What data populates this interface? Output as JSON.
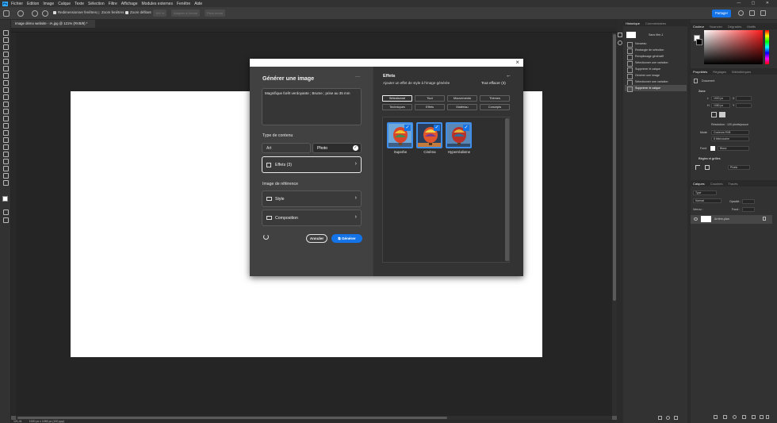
{
  "app": {
    "logo": "Ps",
    "menu": [
      "Fichier",
      "Edition",
      "Image",
      "Calque",
      "Texte",
      "Sélection",
      "Filtre",
      "Affichage",
      "Modules externes",
      "Fenêtre",
      "Aide"
    ],
    "window_controls": "— ▢ ✕"
  },
  "options_bar": {
    "resize_windows": "Redimensionner fenêtres",
    "zoom_windows": "Zoom fenêtres",
    "scrubby_zoom": "Zoom défilant",
    "zoom_100": "100 %",
    "fit_screen": "Adapter à l'écran",
    "fill_screen": "Plein écran",
    "share_label": "Partager"
  },
  "document": {
    "tab_title": "Image démo website - IA.jpg @ 121% (RVB/8) *",
    "status_zoom": "121,41",
    "status_info": "1920 px x 1080 px (120 ppp)"
  },
  "history_panel": {
    "tabs": [
      "Historique",
      "Commentaires"
    ],
    "snapshot": "Sans titre-1",
    "items": [
      "Nouveau",
      "Rectangle de sélection",
      "Remplissage génératif",
      "Sélectionner une variation",
      "Supprimer le calque",
      "Générer une image",
      "Sélectionner une variation",
      "Supprimer le calque"
    ],
    "selected_index": 7
  },
  "color_panel": {
    "tabs": [
      "Couleur",
      "Nuancier",
      "Dégradés",
      "Motifs"
    ]
  },
  "properties_panel": {
    "tabs": [
      "Propriétés",
      "Réglages",
      "Bibliothèques"
    ],
    "doc_label": "Document",
    "canvas_section": "Zone",
    "width_label": "L",
    "width_value": "1920 px",
    "height_label": "H",
    "height_value": "1080 px",
    "x_label": "X",
    "y_label": "Y",
    "resolution": "Résolution : 120 pixels/pouce",
    "mode_label": "Mode",
    "mode_value": "Couleurs RVB",
    "depth_value": "8 bits/couche",
    "fill_label": "Fond",
    "fill_value": "Blanc",
    "rulers_section": "Règles et grilles",
    "units_value": "Pixels"
  },
  "layers_panel": {
    "tabs": [
      "Calques",
      "Couches",
      "Tracés"
    ],
    "search_placeholder": "Type",
    "blend_mode": "Normal",
    "opacity_label": "Opacité :",
    "lock_label": "Verrou :",
    "fill_label": "Fond :",
    "layer_name": "Arrière-plan"
  },
  "dialog": {
    "title": "Générer une image",
    "more": "···",
    "close": "×",
    "prompt": "Magnifique forêt verdoyante ; Brume ; prise au 35 mm",
    "content_type_label": "Type de contenu",
    "content_types": [
      "Art",
      "Photo"
    ],
    "effects_button": "Effets (3)",
    "reference_label": "Image de référence",
    "style_button": "Style",
    "composition_button": "Composition",
    "cancel": "Annuler",
    "generate": "Générer",
    "effects_panel": {
      "title": "Effets",
      "subtitle": "Ajouter un effet de style à l'image générée",
      "clear_all": "Tout effacer (3)",
      "back": "←",
      "filters": [
        "Sélectionné",
        "Tout",
        "Mouvements",
        "Thèmes",
        "Techniques",
        "Effets",
        "Matériau",
        "Concepts"
      ],
      "selected_filter": 0,
      "items": [
        {
          "label": "Superbe"
        },
        {
          "label": "Cinéma"
        },
        {
          "label": "Hyperréalisme"
        }
      ]
    }
  }
}
